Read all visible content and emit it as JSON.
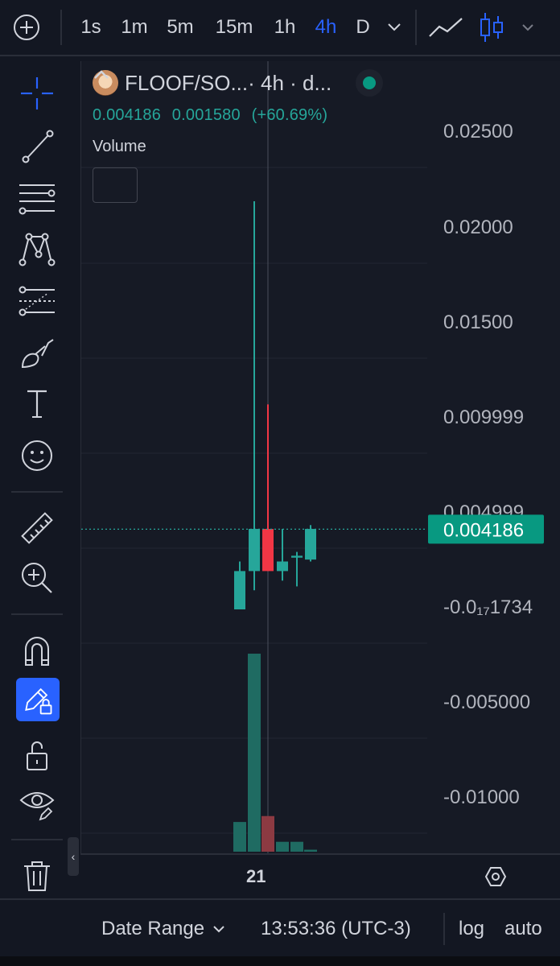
{
  "top_toolbar": {
    "add_icon": "plus-circle-icon",
    "intervals": [
      {
        "label": "1s",
        "active": false
      },
      {
        "label": "1m",
        "active": false
      },
      {
        "label": "5m",
        "active": false
      },
      {
        "label": "15m",
        "active": false
      },
      {
        "label": "1h",
        "active": false
      },
      {
        "label": "4h",
        "active": true
      },
      {
        "label": "D",
        "active": false
      }
    ],
    "more_icon": "chevron-down-icon",
    "chart_type_icons": [
      "line-chart-icon",
      "candles-icon",
      "chevron-down-icon"
    ]
  },
  "left_toolbar": {
    "tools": [
      "crosshair-icon",
      "trend-line-icon",
      "horizontal-lines-icon",
      "pattern-icon",
      "fib-icon",
      "brush-icon",
      "text-icon",
      "emoji-icon",
      "ruler-icon",
      "zoom-in-icon",
      "magnet-icon",
      "lock-drawings-icon",
      "unlock-icon",
      "eye-icon",
      "trash-icon",
      "layers-icon"
    ],
    "active_tool": "lock-drawings-icon"
  },
  "legend": {
    "symbol": "FLOOF/SO...",
    "interval": " · 4h · d...",
    "status": "live",
    "close": "0.004186",
    "change": "0.001580",
    "change_pct": "(+60.69%)",
    "volume_label": "Volume"
  },
  "price_axis": {
    "labels": [
      "0.02500",
      "0.02000",
      "0.01500",
      "0.009999",
      "0.004999",
      "-0.0₁₇1734",
      "-0.005000",
      "-0.01000"
    ],
    "current_price_label": "0.004186"
  },
  "chart_data": {
    "type": "candlestick",
    "interval": "4h",
    "last_price": 0.004186,
    "candles": [
      {
        "open": 0.0,
        "high": 0.0025,
        "low": 0.0,
        "close": 0.002,
        "color": "up"
      },
      {
        "open": 0.002,
        "high": 0.0213,
        "low": 0.001,
        "close": 0.0042,
        "color": "up"
      },
      {
        "open": 0.0042,
        "high": 0.0107,
        "low": 0.002,
        "close": 0.002,
        "color": "down"
      },
      {
        "open": 0.002,
        "high": 0.0042,
        "low": 0.0015,
        "close": 0.0025,
        "color": "up"
      },
      {
        "open": 0.0028,
        "high": 0.003,
        "low": 0.0012,
        "close": 0.0027,
        "color": "up"
      },
      {
        "open": 0.0026,
        "high": 0.0044,
        "low": 0.0025,
        "close": 0.0042,
        "color": "up"
      }
    ],
    "volume_relative": [
      0.15,
      1.0,
      0.18,
      0.05,
      0.05,
      0.01
    ],
    "x_tick_labels": [
      "21"
    ],
    "colors": {
      "up": "#26a69a",
      "down": "#f23645",
      "vol_up": "#1f6b62",
      "vol_down": "#8c3a42"
    }
  },
  "time_axis": {
    "label": "21",
    "settings_icon": "hexagon-settings-icon"
  },
  "bottom_bar": {
    "date_range": "Date Range",
    "time": "13:53:36 (UTC-3)",
    "log": "log",
    "auto": "auto"
  }
}
